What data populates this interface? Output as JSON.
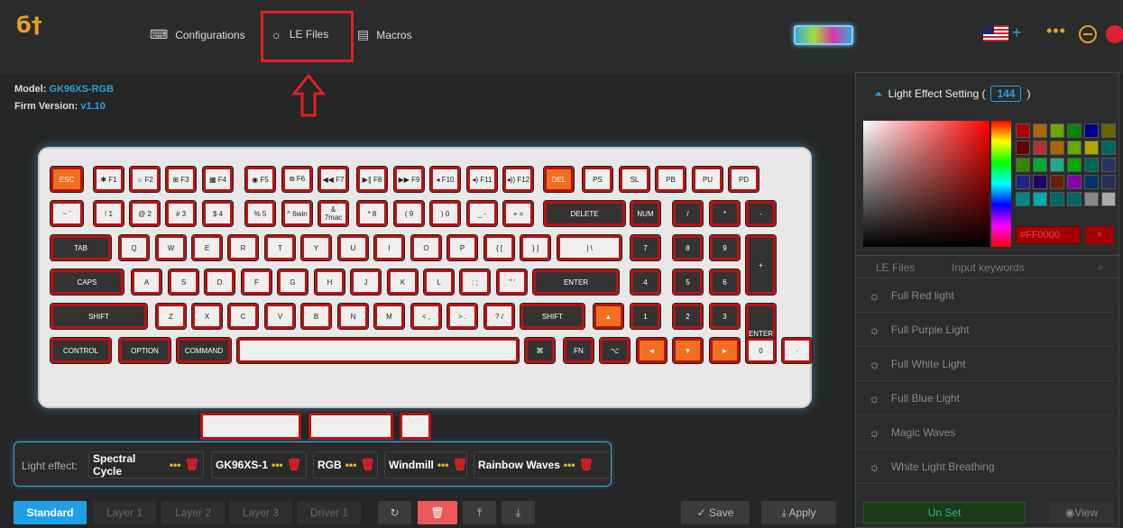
{
  "topbar": {
    "logo": "б†",
    "nav": [
      {
        "label": "Configurations",
        "icon": "keyboard-icon"
      },
      {
        "label": "LE Files",
        "icon": "bulb-icon"
      },
      {
        "label": "Macros",
        "icon": "document-icon"
      }
    ]
  },
  "device": {
    "model_label": "Model:",
    "model": "GK96XS-RGB",
    "firm_label": "Firm Version:",
    "firm": "v1.10"
  },
  "keys": {
    "row0": [
      "ESC",
      "✱ F1",
      "☼ F2",
      "⊞ F3",
      "▦ F4",
      "◉ F5",
      "⧉ F6",
      "◀◀ F7",
      "▶∥ F8",
      "▶▶ F9",
      "◂ F10",
      "◂) F11",
      "◂)) F12",
      "DEL",
      "PS",
      "SL",
      "PB",
      "PU",
      "PD"
    ],
    "row1": [
      "~ `",
      "! 1",
      "@ 2",
      "# 3",
      "$ 4",
      "% 5",
      "^ 6win",
      "& 7mac",
      "* 8",
      "( 9",
      ") 0",
      "_ -",
      "+ =",
      "DELETE",
      "NUM",
      "/",
      "*",
      "-"
    ],
    "row2": [
      "TAB",
      "Q",
      "W",
      "E",
      "R",
      "T",
      "Y",
      "U",
      "I",
      "O",
      "P",
      "{ [",
      "} ]",
      "| \\",
      "7",
      "8",
      "9",
      "+"
    ],
    "row3": [
      "CAPS",
      "A",
      "S",
      "D",
      "F",
      "G",
      "H",
      "J",
      "K",
      "L",
      ": ;",
      "\" '",
      "ENTER",
      "4",
      "5",
      "6"
    ],
    "row4": [
      "SHIFT",
      "Z",
      "X",
      "C",
      "V",
      "B",
      "N",
      "M",
      "< ,",
      "> .",
      "? /",
      "SHIFT",
      "▲",
      "1",
      "2",
      "3",
      "ENTER"
    ],
    "row5": [
      "CONTROL",
      "OPTION",
      "COMMAND",
      "",
      "⌘",
      "FN",
      "⌥",
      "◄",
      "▼",
      "►",
      "0",
      "·"
    ]
  },
  "effects": {
    "label": "Light effect:",
    "items": [
      "Spectral Cycle",
      "GK96XS-1",
      "RGB",
      "Windmill",
      "Rainbow Waves"
    ]
  },
  "layers": {
    "tabs": [
      "Standard",
      "Layer 1",
      "Layer 2",
      "Layer 3",
      "Driver 1"
    ],
    "active": "Standard"
  },
  "actions": {
    "save": "✓ Save",
    "apply": "⤓ Apply"
  },
  "panel": {
    "title": "Light Effect Setting (",
    "count": "144",
    "title_end": ")",
    "hex": "#FF0000",
    "tabs": [
      "LE Files",
      "Input keywords"
    ],
    "items": [
      "Full Red light",
      "Full Purple Light",
      "Full White Light",
      "Full Blue Light",
      "Magic Waves",
      "White Light Breathing"
    ],
    "unset": "Un Set",
    "view": "View"
  },
  "colors": {
    "accent": "#1ea0e8",
    "brand": "#e8a020",
    "key_border": "#bb1111",
    "highlight": "#e02020"
  }
}
